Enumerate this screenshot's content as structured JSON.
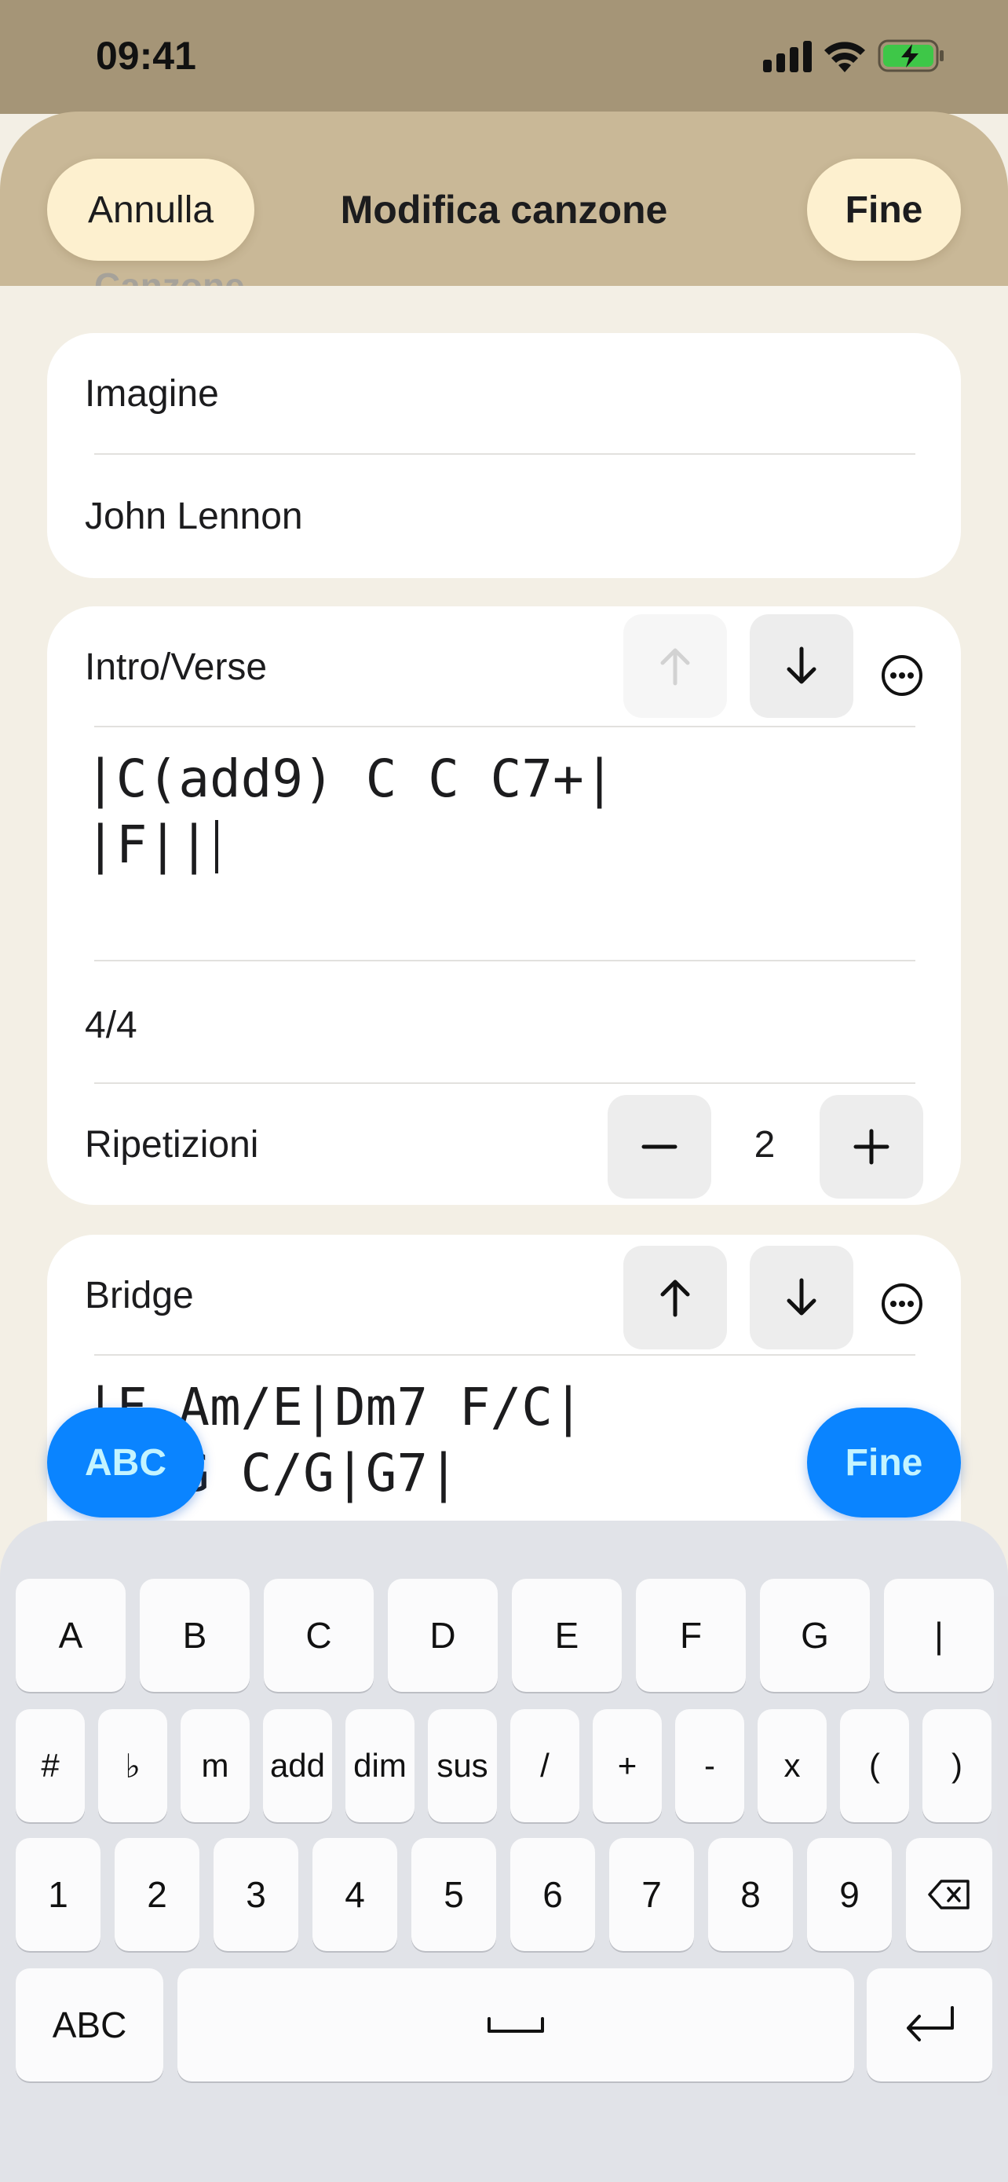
{
  "status_bar": {
    "time": "09:41",
    "icons": [
      "cellular-signal-icon",
      "wifi-icon",
      "battery-charging-icon"
    ],
    "battery_color": "#3ec748"
  },
  "nav": {
    "cancel_label": "Annulla",
    "title": "Modifica canzone",
    "done_label": "Fine"
  },
  "song": {
    "section_header": "Canzone",
    "title_value": "Imagine",
    "artist_value": "John Lennon"
  },
  "sections": [
    {
      "name": "Intro/Verse",
      "chords_line1": "|C(add9) C C C7+|",
      "chords_line2": "|F||",
      "time_signature": "4/4",
      "repeat_label": "Ripetizioni",
      "repeat_count": "2",
      "move_up_enabled": false,
      "move_down_enabled": true
    },
    {
      "name": "Bridge",
      "chords_line1": "|F Am/E|Dm7 F/C|",
      "chords_line2": "|G G C/G|G7|",
      "move_up_enabled": true,
      "move_down_enabled": true
    }
  ],
  "keyboard_accessory": {
    "abc_label": "ABC",
    "done_label": "Fine",
    "accent_color": "#0a84ff"
  },
  "keyboard": {
    "row1": [
      "A",
      "B",
      "C",
      "D",
      "E",
      "F",
      "G",
      "|"
    ],
    "row2": [
      "#",
      "♭",
      "m",
      "add",
      "dim",
      "sus",
      "/",
      "+",
      "-",
      "x",
      "(",
      ")"
    ],
    "row3": [
      "1",
      "2",
      "3",
      "4",
      "5",
      "6",
      "7",
      "8",
      "9"
    ],
    "abc_label": "ABC",
    "icons": [
      "backspace-icon",
      "space-icon",
      "return-icon"
    ]
  }
}
